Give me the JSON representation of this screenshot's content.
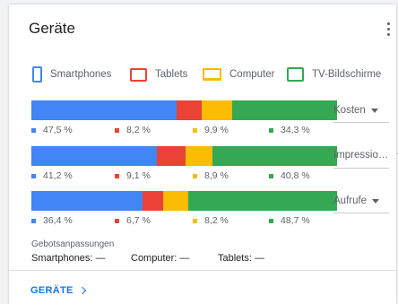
{
  "card": {
    "title": "Geräte",
    "more_icon": "more-vert-icon"
  },
  "colors": {
    "smartphones": "#4285f4",
    "tablets": "#ea4335",
    "computer": "#fbbc04",
    "tv": "#34a853"
  },
  "legend": [
    {
      "label": "Smartphones",
      "icon": "smartphone-icon"
    },
    {
      "label": "Tablets",
      "icon": "tablet-icon"
    },
    {
      "label": "Computer",
      "icon": "computer-icon"
    },
    {
      "label": "TV-Bildschirme",
      "icon": "tv-icon"
    }
  ],
  "chart_data": {
    "type": "bar",
    "stacked": true,
    "orientation": "horizontal",
    "series_names": [
      "Smartphones",
      "Tablets",
      "Computer",
      "TV-Bildschirme"
    ],
    "rows": [
      {
        "metric": "Kosten",
        "values": [
          47.5,
          8.2,
          9.9,
          34.3
        ],
        "labels": [
          "47,5 %",
          "8,2 %",
          "9,9 %",
          "34,3 %"
        ]
      },
      {
        "metric": "Impressio…",
        "values": [
          41.2,
          9.1,
          8.9,
          40.8
        ],
        "labels": [
          "41,2 %",
          "9,1 %",
          "8,9 %",
          "40,8 %"
        ]
      },
      {
        "metric": "Aufrufe",
        "values": [
          36.4,
          6.7,
          8.2,
          48.7
        ],
        "labels": [
          "36,4 %",
          "6,7 %",
          "8,2 %",
          "48,7 %"
        ]
      }
    ]
  },
  "bid_adjustments": {
    "label": "Gebotsanpassungen",
    "smartphones": "Smartphones: —",
    "computer": "Computer: —",
    "tablets": "Tablets: —"
  },
  "footer": {
    "link_label": "GERÄTE"
  }
}
